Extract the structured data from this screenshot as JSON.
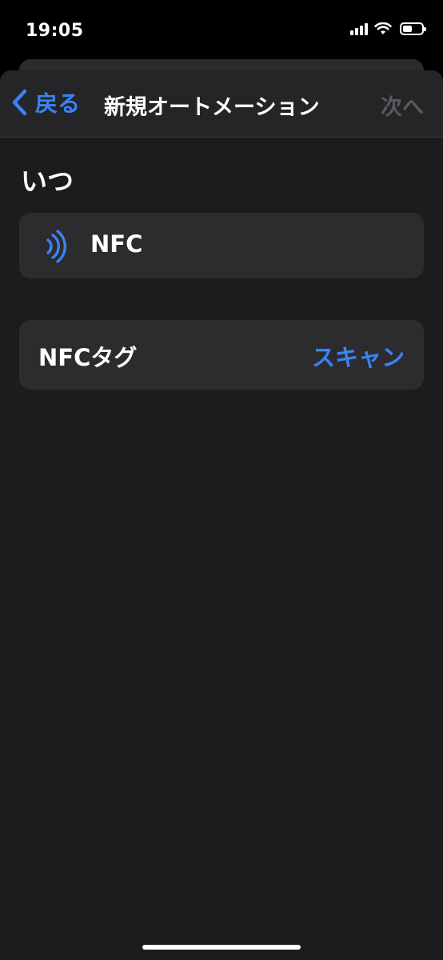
{
  "status_bar": {
    "time": "19:05",
    "signal_icon": "signal-bars-icon",
    "wifi_icon": "wifi-icon",
    "battery_icon": "battery-icon",
    "battery_level": 0.5
  },
  "nav": {
    "back_label": "戻る",
    "back_icon": "chevron-left-icon",
    "title": "新規オートメーション",
    "next_label": "次へ"
  },
  "section": {
    "title": "いつ"
  },
  "trigger": {
    "icon": "nfc-icon",
    "label": "NFC"
  },
  "tag_row": {
    "label": "NFCタグ",
    "action_label": "スキャン"
  },
  "colors": {
    "accent": "#3b82f6",
    "background": "#1c1c1e",
    "card": "#2c2c2e",
    "disabled": "#5a5a5e"
  }
}
